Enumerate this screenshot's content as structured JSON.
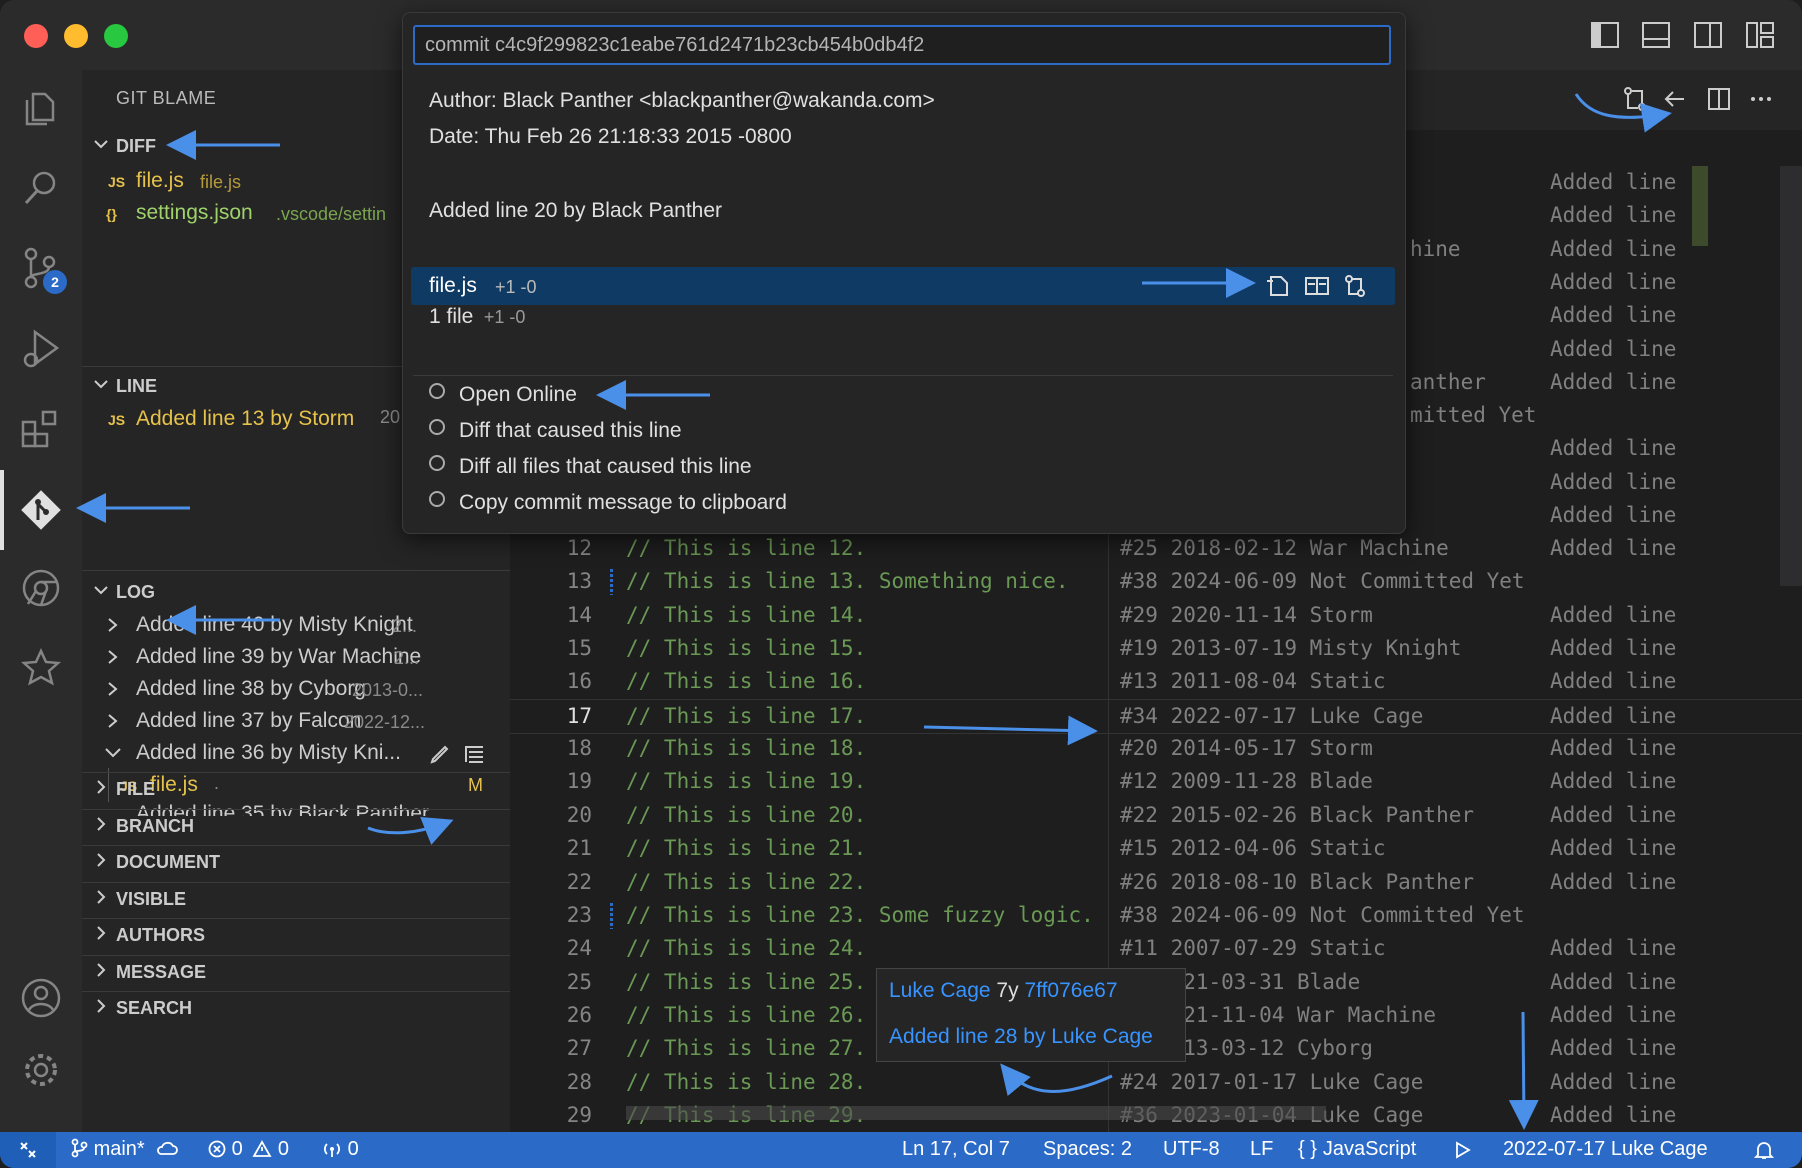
{
  "quick_pick": {
    "input_value": "commit c4c9f299823c1eabe761d2471b23cb454b0db4f2",
    "author": "Author: Black Panther <blackpanther@wakanda.com>",
    "date": "Date: Thu Feb 26 21:18:33 2015 -0800",
    "message": "Added line 20 by Black Panther",
    "selected_file": {
      "name": "file.js",
      "stats": "+1 -0"
    },
    "summary": {
      "name": "1 file",
      "stats": "+1 -0"
    },
    "options": [
      "Open Online",
      "Diff that caused this line",
      "Diff all files that caused this line",
      "Copy commit message to clipboard"
    ]
  },
  "sidebar": {
    "title": "GIT BLAME",
    "diff": {
      "heading": "DIFF",
      "files": [
        {
          "icon": "JS",
          "name": "file.js",
          "path": "file.js"
        },
        {
          "icon": "{}",
          "name": "settings.json",
          "path": ".vscode/settin"
        }
      ]
    },
    "line": {
      "heading": "LINE",
      "item": {
        "icon": "JS",
        "label": "Added line 13 by Storm",
        "suffix": "20"
      }
    },
    "log": {
      "heading": "LOG",
      "items": [
        {
          "label": "Added line 40 by Misty Knight",
          "suffix": "2..."
        },
        {
          "label": "Added line 39 by War Machine",
          "suffix": "2..."
        },
        {
          "label": "Added line 38 by Cyborg",
          "suffix": "2013-0..."
        },
        {
          "label": "Added line 37 by Falcon",
          "suffix": "2022-12..."
        },
        {
          "label": "Added line 36 by Misty Kni...",
          "suffix": ""
        }
      ],
      "child_file": {
        "icon": "JS",
        "name": "file.js",
        "path": ".",
        "status": "M"
      },
      "partial": "Added line 35 by Black Panther"
    },
    "collapsed_sections": [
      "FILE",
      "BRANCH",
      "DOCUMENT",
      "VISIBLE",
      "AUTHORS",
      "MESSAGE",
      "SEARCH"
    ]
  },
  "activity_badge": "2",
  "editor": {
    "partial_blame_top": [
      {
        "blame": "",
        "added": "Added line"
      },
      {
        "blame": "",
        "added": "Added line"
      },
      {
        "blame": "hine",
        "added": "Added line"
      },
      {
        "blame": "",
        "added": "Added line"
      },
      {
        "blame": "",
        "added": "Added line"
      },
      {
        "blame": "",
        "added": "Added line"
      },
      {
        "blame": "anther",
        "added": "Added line"
      },
      {
        "blame": "mitted Yet",
        "added": ""
      },
      {
        "blame": "",
        "added": "Added line"
      },
      {
        "blame": "",
        "added": "Added line"
      },
      {
        "blame": "",
        "added": "Added line"
      }
    ],
    "lines": [
      {
        "n": "12",
        "code": "// This is line 12.",
        "blame": "#25 2018-02-12 War Machine",
        "added": "Added line"
      },
      {
        "n": "13",
        "code": "// This is line 13. Something nice.",
        "blame": "#38 2024-06-09 Not Committed Yet",
        "added": ""
      },
      {
        "n": "14",
        "code": "// This is line 14.",
        "blame": "#29 2020-11-14 Storm",
        "added": "Added line"
      },
      {
        "n": "15",
        "code": "// This is line 15.",
        "blame": "#19 2013-07-19 Misty Knight",
        "added": "Added line"
      },
      {
        "n": "16",
        "code": "// This is line 16.",
        "blame": "#13 2011-08-04 Static",
        "added": "Added line"
      },
      {
        "n": "17",
        "code": "// This is line 17.",
        "blame": "#34 2022-07-17 Luke Cage",
        "added": "Added line"
      },
      {
        "n": "18",
        "code": "// This is line 18.",
        "blame": "#20 2014-05-17 Storm",
        "added": "Added line"
      },
      {
        "n": "19",
        "code": "// This is line 19.",
        "blame": "#12 2009-11-28 Blade",
        "added": "Added line"
      },
      {
        "n": "20",
        "code": "// This is line 20.",
        "blame": "#22 2015-02-26 Black Panther",
        "added": "Added line"
      },
      {
        "n": "21",
        "code": "// This is line 21.",
        "blame": "#15 2012-04-06 Static",
        "added": "Added line"
      },
      {
        "n": "22",
        "code": "// This is line 22.",
        "blame": "#26 2018-08-10 Black Panther",
        "added": "Added line"
      },
      {
        "n": "23",
        "code": "// This is line 23. Some fuzzy logic.",
        "blame": "#38 2024-06-09 Not Committed Yet",
        "added": ""
      },
      {
        "n": "24",
        "code": "// This is line 24.",
        "blame": "#11 2007-07-29 Static",
        "added": "Added line"
      },
      {
        "n": "25",
        "code": "// This is line 25.",
        "blame": "#  2021-03-31 Blade",
        "added": "Added line"
      },
      {
        "n": "26",
        "code": "// This is line 26.",
        "blame": "#  2021-11-04 War Machine",
        "added": "Added line"
      },
      {
        "n": "27",
        "code": "// This is line 27.",
        "blame": "#  2013-03-12 Cyborg",
        "added": "Added line"
      },
      {
        "n": "28",
        "code": "// This is line 28.",
        "blame": "#24 2017-01-17 Luke Cage",
        "added": "Added line"
      },
      {
        "n": "29",
        "code": "// This is line 29.",
        "blame": "#36 2023-01-04 Luke Cage",
        "added": "Added line"
      }
    ],
    "hover": {
      "author": "Luke Cage",
      "age": "7y",
      "hash": "7ff076e67",
      "message": "Added line 28 by Luke Cage"
    }
  },
  "status_bar": {
    "branch": "main*",
    "errors": "0",
    "warnings": "0",
    "ports": "0",
    "position": "Ln 17, Col 7",
    "spaces": "Spaces: 2",
    "encoding": "UTF-8",
    "eol": "LF",
    "language": "JavaScript",
    "blame": "2022-07-17 Luke Cage"
  },
  "colors": {
    "accent": "#2b6bc7",
    "arrow": "#4a8fe8",
    "comment": "#6a9955",
    "js_icon": "#e6c24a",
    "json_name": "#9fd36a"
  }
}
